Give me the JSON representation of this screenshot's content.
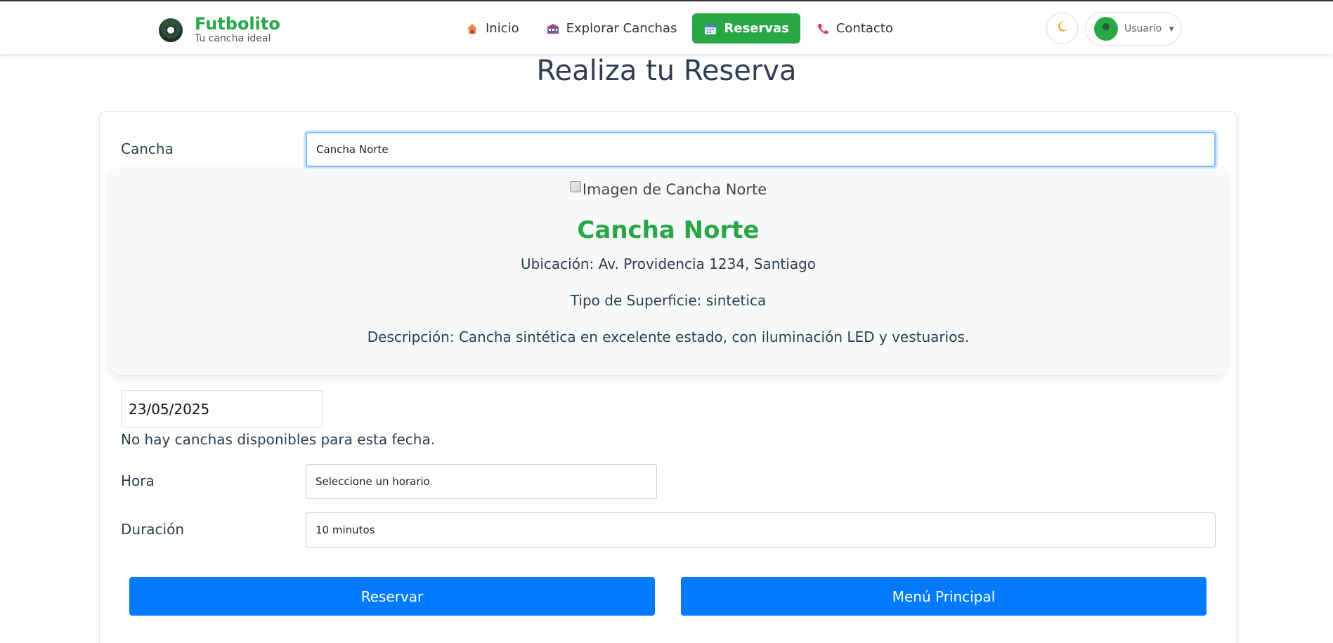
{
  "brand": {
    "name": "Futbolito",
    "tagline": "Tu cancha ideal"
  },
  "nav": {
    "items": [
      {
        "label": "Inicio",
        "icon": "house-icon",
        "active": false
      },
      {
        "label": "Explorar Canchas",
        "icon": "stadium-icon",
        "active": false
      },
      {
        "label": "Reservas",
        "icon": "calendar-icon",
        "active": true
      },
      {
        "label": "Contacto",
        "icon": "phone-icon",
        "active": false
      }
    ],
    "theme_icon": "moon-icon",
    "user_label": "Usuario"
  },
  "page": {
    "title": "Realiza tu Reserva"
  },
  "form": {
    "cancha_label": "Cancha",
    "cancha_value": "Cancha Norte",
    "court_detail": {
      "image_alt": "Imagen de Cancha Norte",
      "name": "Cancha Norte",
      "ubicacion": "Ubicación: Av. Providencia 1234, Santiago",
      "superficie": "Tipo de Superficie: sintetica",
      "descripcion": "Descripción: Cancha sintética en excelente estado, con iluminación LED y vestuarios."
    },
    "date_value": "23/05/2025",
    "no_availability": "No hay canchas disponibles para esta fecha.",
    "hora_label": "Hora",
    "hora_value": "Seleccione un horario",
    "duracion_label": "Duración",
    "duracion_value": "10 minutos",
    "reservar_label": "Reservar",
    "menu_label": "Menú Principal"
  },
  "colors": {
    "brand_green": "#28a745",
    "primary_blue": "#007bff",
    "text_dark": "#2c3e50"
  }
}
